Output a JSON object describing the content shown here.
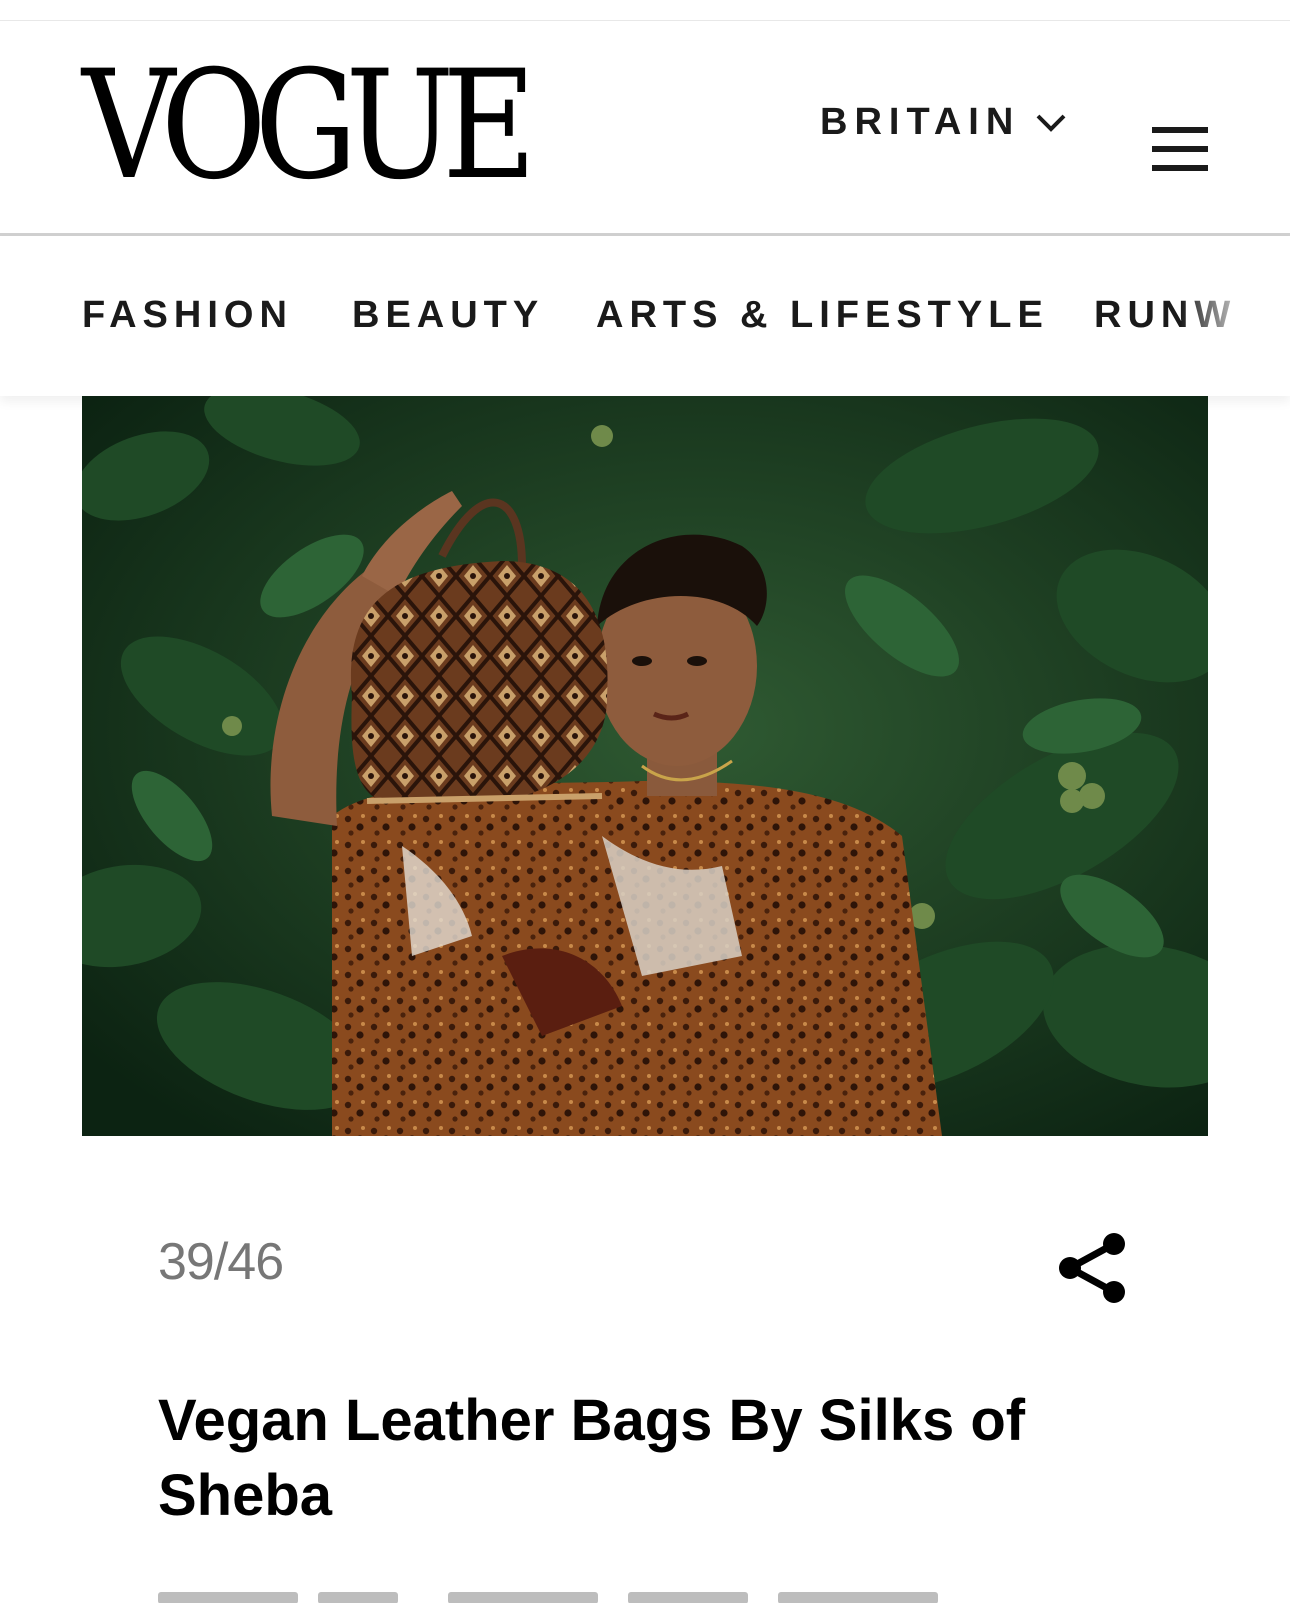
{
  "brand": {
    "logo_text": "VOGUE"
  },
  "header": {
    "edition_label": "BRITAIN",
    "edition_icon": "chevron-down-icon",
    "menu_icon": "hamburger-menu-icon"
  },
  "nav": {
    "items": [
      "FASHION",
      "BEAUTY",
      "ARTS & LIFESTYLE",
      "RUNW"
    ]
  },
  "gallery": {
    "current": 39,
    "total": 46,
    "counter_text": "39/46",
    "share_icon": "share-icon"
  },
  "article": {
    "headline": "Vegan Leather Bags By Silks of Sheba"
  },
  "colors": {
    "text": "#1a1a1a",
    "counter": "#777777",
    "divider": "#d0d0d0",
    "foliage": "#1d4a27"
  }
}
